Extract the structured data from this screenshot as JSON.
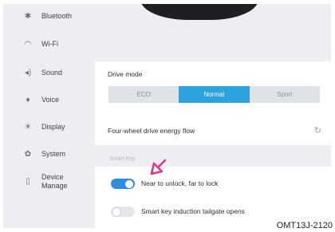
{
  "sidebar": {
    "items": [
      {
        "icon": "bluetooth-icon",
        "glyph": "✱",
        "label": "Bluetooth"
      },
      {
        "icon": "wifi-icon",
        "glyph": "◠",
        "label": "Wi-Fi"
      },
      {
        "icon": "sound-icon",
        "glyph": "◂)",
        "label": "Sound"
      },
      {
        "icon": "voice-icon",
        "glyph": "♦",
        "label": "Voice"
      },
      {
        "icon": "display-icon",
        "glyph": "☀",
        "label": "Display"
      },
      {
        "icon": "system-icon",
        "glyph": "✿",
        "label": "System"
      },
      {
        "icon": "device-manage-icon",
        "glyph": "▯",
        "label_line1": "Device",
        "label_line2": "Manage"
      }
    ]
  },
  "drive": {
    "title": "Drive mode",
    "modes": [
      "ECO",
      "Normal",
      "Sport"
    ],
    "selected": "Normal",
    "energy_flow_label": "Four-wheel drive energy flow"
  },
  "smart_key": {
    "section_label": "Smart Key",
    "toggles": [
      {
        "label": "Near to unlock, far to lock",
        "state": "on"
      },
      {
        "label": "Smart key induction tailgate opens",
        "state": "off"
      }
    ]
  },
  "caption": "OMT13J-2120",
  "colors": {
    "accent": "#2ea1df",
    "toggle_on": "#2e8fe0",
    "arrow": "#e0338a",
    "background": "#eceef1"
  }
}
